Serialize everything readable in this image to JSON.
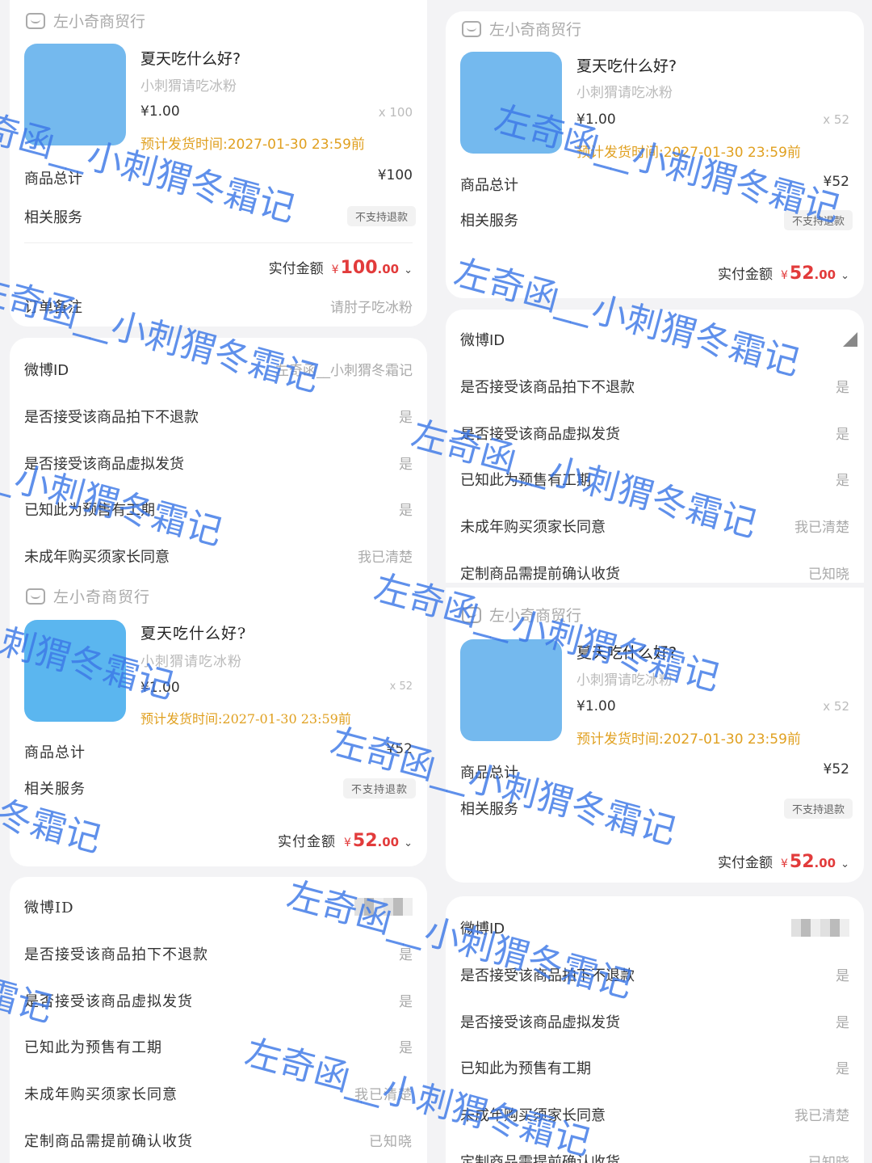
{
  "store_name": "左小奇商贸行",
  "product": {
    "title": "夏天吃什么好?",
    "subtitle": "小刺猬请吃冰粉",
    "unit_price": "¥1.00",
    "ship_time": "预计发货时间:2027-01-30 23:59前"
  },
  "labels": {
    "goods_total": "商品总计",
    "service": "相关服务",
    "no_refund_badge": "不支持退款",
    "paid_amount": "实付金额",
    "order_note": "订单备注",
    "weibo_id": "微博ID",
    "q_no_refund": "是否接受该商品拍下不退款",
    "q_virtual": "是否接受该商品虚拟发货",
    "q_presale": "已知此为预售有工期",
    "q_minor": "未成年购买须家长同意",
    "q_custom": "定制商品需提前确认收货"
  },
  "answers": {
    "yes": "是",
    "minor": "我已清楚",
    "custom": "已知晓"
  },
  "orders": {
    "o1": {
      "qty": "x 100",
      "total": "¥100",
      "paid_yen": "¥",
      "paid_int": "100",
      "paid_dec": ".00",
      "note": "请肘子吃冰粉",
      "weibo": "左奇函__小刺猬冬霜记"
    },
    "o2": {
      "qty": "x 52",
      "total": "¥52",
      "paid_yen": "¥",
      "paid_int": "52",
      "paid_dec": ".00"
    },
    "o3": {
      "qty": "x 52",
      "total": "¥52",
      "paid_yen": "¥",
      "paid_int": "52",
      "paid_dec": ".00"
    },
    "o4": {
      "qty": "x 52",
      "total": "¥52",
      "paid_yen": "¥",
      "paid_int": "52",
      "paid_dec": ".00"
    }
  },
  "watermark_text": "左奇函__小刺猬冬霜记",
  "colors": {
    "accent_red": "#e23b3b",
    "ship_orange": "#e0a020",
    "thumb_blue": "#74b9ee",
    "watermark_blue": "#3c78e6"
  }
}
